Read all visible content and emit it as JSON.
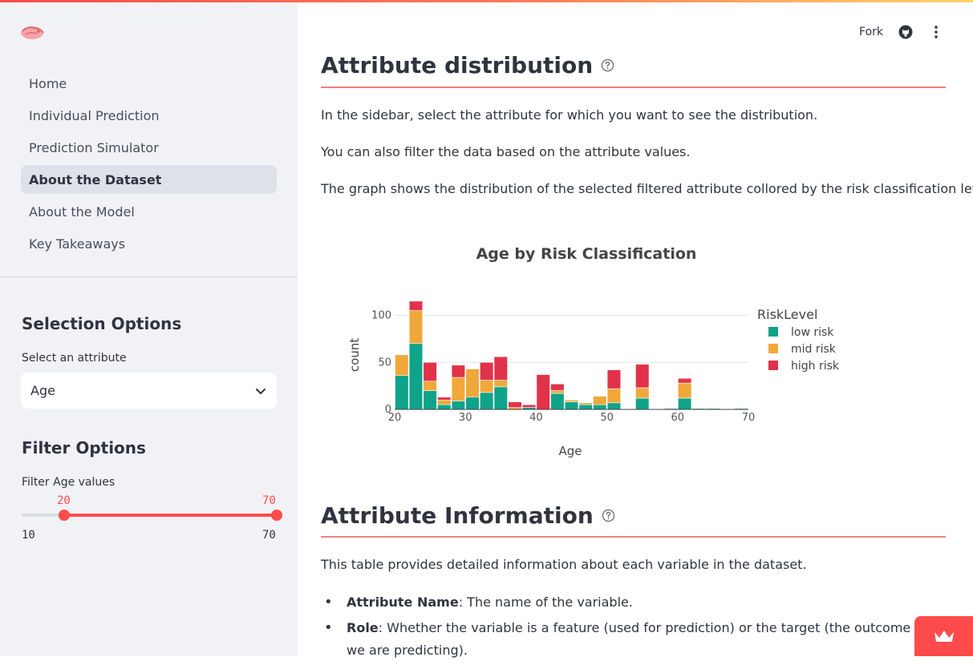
{
  "sidebar": {
    "nav": [
      {
        "label": "Home",
        "active": false
      },
      {
        "label": "Individual Prediction",
        "active": false
      },
      {
        "label": "Prediction Simulator",
        "active": false
      },
      {
        "label": "About the Dataset",
        "active": true
      },
      {
        "label": "About the Model",
        "active": false
      },
      {
        "label": "Key Takeaways",
        "active": false
      }
    ],
    "selection_title": "Selection Options",
    "select_label": "Select an attribute",
    "select_value": "Age",
    "filter_title": "Filter Options",
    "filter_label": "Filter Age values",
    "slider": {
      "min": 10,
      "max": 70,
      "low": 20,
      "high": 70,
      "min_label": "10",
      "max_label": "70",
      "low_label": "20",
      "high_label": "70"
    }
  },
  "header": {
    "fork_label": "Fork",
    "icons": [
      "github-icon",
      "kebab-menu-icon"
    ]
  },
  "main": {
    "section1_title": "Attribute distribution",
    "p1": "In the sidebar, select the attribute for which you want to see the distribution.",
    "p2": "You can also filter the data based on the attribute values.",
    "p3": "The graph shows the distribution of the selected filtered attribute collored by the risk classification level.",
    "section2_title": "Attribute Information",
    "p4": "This table provides detailed information about each variable in the dataset.",
    "bullets": [
      {
        "term": "Attribute Name",
        "text": ": The name of the variable."
      },
      {
        "term": "Role",
        "text": ": Whether the variable is a feature (used for prediction) or the target (the outcome we are predicting)."
      }
    ]
  },
  "colors": {
    "accent": "#ff4b4b",
    "low_risk": "#0fa38a",
    "mid_risk": "#f0a83a",
    "high_risk": "#e0334a"
  },
  "chart_data": {
    "type": "bar",
    "title": "Age by Risk Classification",
    "xlabel": "Age",
    "ylabel": "count",
    "xlim": [
      20,
      70
    ],
    "ylim": [
      0,
      120
    ],
    "xticks": [
      20,
      30,
      40,
      50,
      60,
      70
    ],
    "yticks": [
      0,
      50,
      100
    ],
    "legend_title": "RiskLevel",
    "legend_position": "right",
    "grid": true,
    "bin_width": 2,
    "categories": [
      20,
      22,
      24,
      26,
      28,
      30,
      32,
      34,
      36,
      38,
      40,
      42,
      44,
      46,
      48,
      50,
      52,
      54,
      56,
      58,
      60,
      62,
      64,
      66,
      68
    ],
    "series": [
      {
        "name": "low risk",
        "values": [
          36,
          70,
          20,
          5,
          9,
          13,
          18,
          24,
          0,
          2,
          0,
          17,
          8,
          5,
          5,
          7,
          0,
          12,
          0,
          1,
          12,
          1,
          1,
          0,
          1
        ]
      },
      {
        "name": "mid risk",
        "values": [
          22,
          35,
          10,
          5,
          25,
          30,
          13,
          7,
          2,
          0,
          0,
          3,
          2,
          2,
          9,
          15,
          0,
          11,
          0,
          0,
          16,
          0,
          0,
          0,
          0
        ]
      },
      {
        "name": "high risk",
        "values": [
          0,
          10,
          20,
          3,
          13,
          0,
          19,
          25,
          6,
          3,
          37,
          7,
          0,
          0,
          0,
          20,
          0,
          25,
          0,
          0,
          5,
          0,
          0,
          0,
          0
        ]
      }
    ]
  }
}
